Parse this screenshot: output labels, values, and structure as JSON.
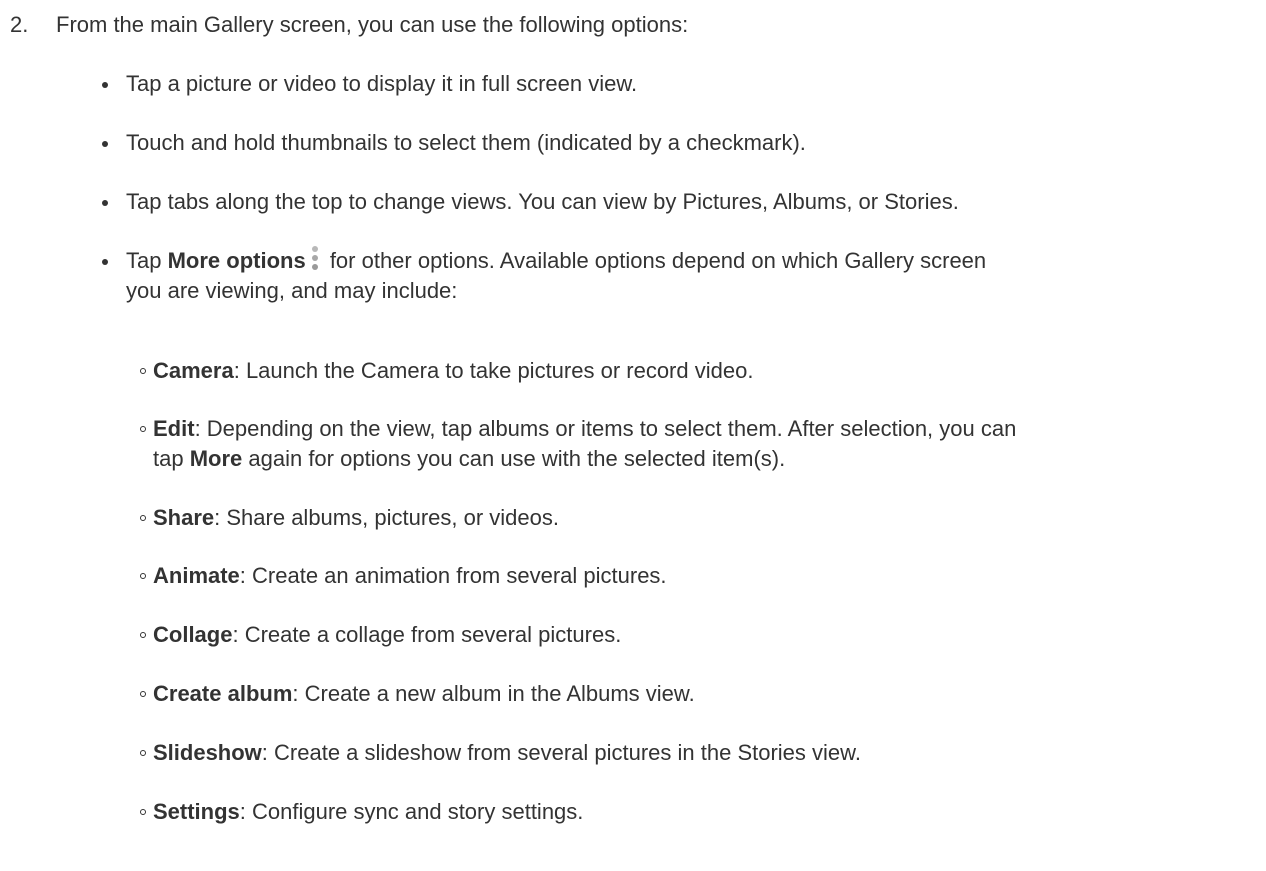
{
  "step": {
    "number": "2.",
    "text": "From the main Gallery screen, you can use the following options:"
  },
  "bullets": [
    {
      "text": "Tap a picture or video to display it in full screen view."
    },
    {
      "text": "Touch and hold thumbnails to select them (indicated by a checkmark)."
    },
    {
      "text": "Tap tabs along the top to change views. You can view by Pictures, Albums, or Stories."
    },
    {
      "prefix": "Tap ",
      "bold": "More options",
      "icon": "more-options-vertical-dots-icon",
      "line1": " for other options. Available options depend on which Gallery screen",
      "line2": "you are viewing, and may include:"
    }
  ],
  "options": [
    {
      "term": "Camera",
      "desc": ": Launch the Camera to take pictures or record video."
    },
    {
      "term": "Edit",
      "desc": ": Depending on the view, tap albums or items to select them. After selection, you can",
      "line2_prefix": "tap ",
      "line2_bold": "More",
      "line2_suffix": " again for options you can use with the selected item(s)."
    },
    {
      "term": "Share",
      "desc": ": Share albums, pictures, or videos."
    },
    {
      "term": "Animate",
      "desc": ": Create an animation from several pictures."
    },
    {
      "term": "Collage",
      "desc": ": Create a collage from several pictures."
    },
    {
      "term": "Create album",
      "desc": ": Create a new album in the Albums view."
    },
    {
      "term": "Slideshow",
      "desc": ": Create a slideshow from several pictures in the Stories view."
    },
    {
      "term": "Settings",
      "desc": ": Configure sync and story settings."
    }
  ],
  "colors": {
    "text": "#333333",
    "icon": "#a8a8a8"
  }
}
